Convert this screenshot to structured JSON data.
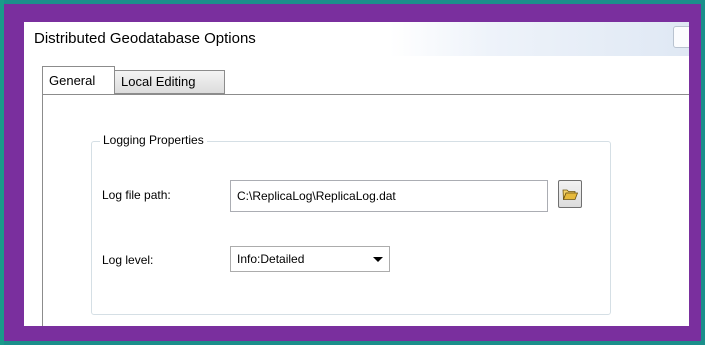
{
  "window": {
    "title": "Distributed Geodatabase Options"
  },
  "tabs": [
    {
      "label": "General",
      "active": true
    },
    {
      "label": "Local Editing",
      "active": false
    }
  ],
  "logging": {
    "group_label": "Logging Properties",
    "path_label": "Log file path:",
    "path_value": "C:\\ReplicaLog\\ReplicaLog.dat",
    "level_label": "Log level:",
    "level_value": "Info:Detailed"
  },
  "icons": {
    "browse": "folder-open-icon",
    "dropdown": "chevron-down-icon"
  },
  "colors": {
    "desktop": "#1b8f8b",
    "frame": "#7a2f9e",
    "folder": "#e6c24a"
  }
}
